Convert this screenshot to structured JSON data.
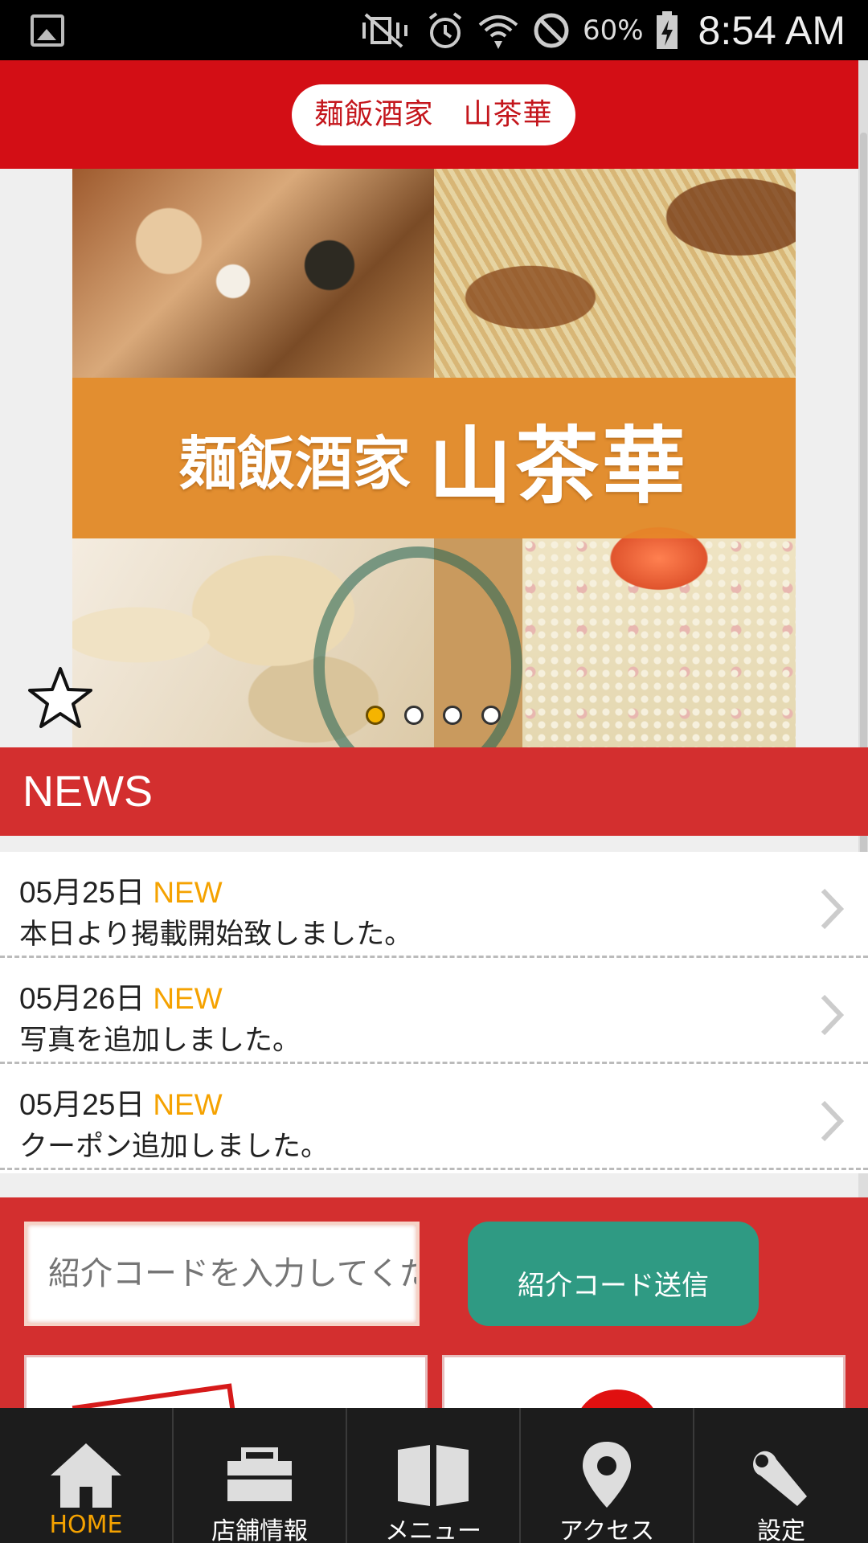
{
  "status_bar": {
    "battery_percent": "60%",
    "time": "8:54 AM"
  },
  "header": {
    "title": "麺飯酒家　山茶華"
  },
  "hero": {
    "banner_text_small": "麺飯酒家",
    "banner_text_big": "山茶華",
    "slide_count": 4,
    "active_slide": 1
  },
  "news": {
    "title": "NEWS",
    "items": [
      {
        "date": "05月25日",
        "badge": "NEW",
        "text": "本日より掲載開始致しました。"
      },
      {
        "date": "05月26日",
        "badge": "NEW",
        "text": "写真を追加しました。"
      },
      {
        "date": "05月25日",
        "badge": "NEW",
        "text": "クーポン追加しました。"
      }
    ]
  },
  "referral": {
    "placeholder": "紹介コードを入力してください",
    "submit_label": "紹介コード送信"
  },
  "bottom_nav": {
    "items": [
      {
        "label": "HOME",
        "icon": "home-icon",
        "active": true
      },
      {
        "label": "店舗情報",
        "icon": "shop-icon",
        "active": false
      },
      {
        "label": "メニュー",
        "icon": "book-icon",
        "active": false
      },
      {
        "label": "アクセス",
        "icon": "location-pin-icon",
        "active": false
      },
      {
        "label": "設定",
        "icon": "wrench-icon",
        "active": false
      }
    ]
  },
  "colors": {
    "header_red": "#d30e15",
    "section_red": "#d32f2f",
    "accent_orange": "#f5a200",
    "button_teal": "#2f9a83",
    "nav_dark": "#1c1c1c"
  }
}
